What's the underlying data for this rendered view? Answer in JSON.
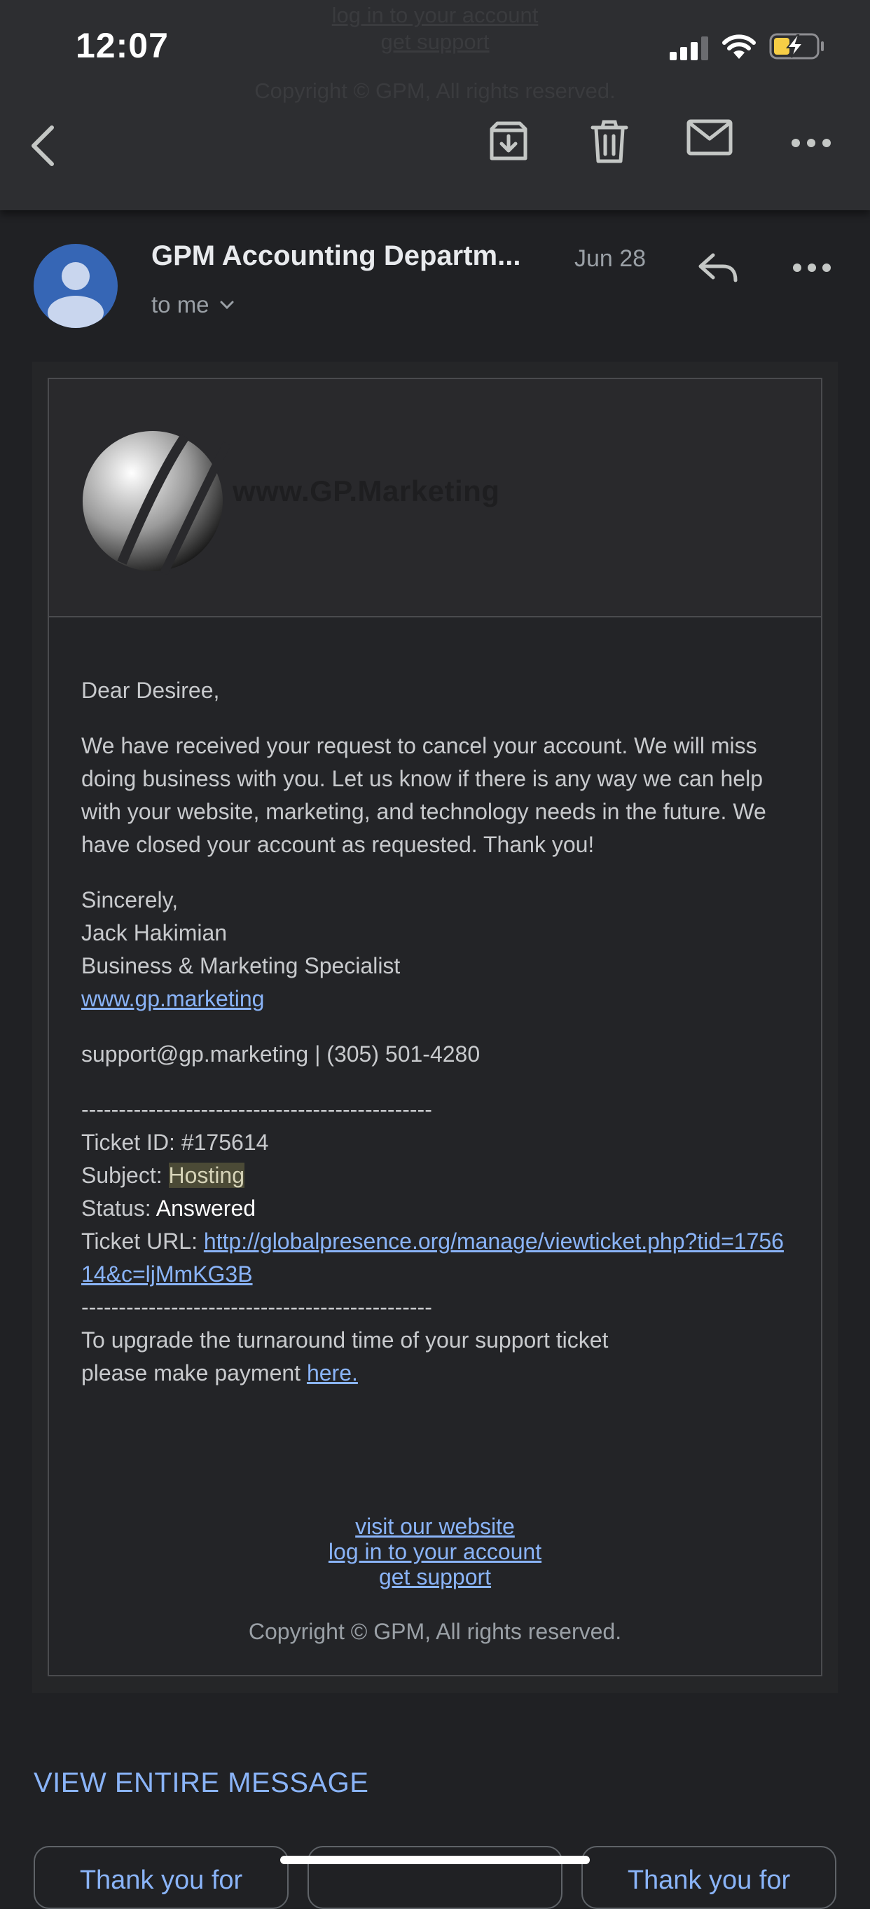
{
  "status_bar": {
    "time": "12:07"
  },
  "ghost_footer": {
    "line1": "log in to your account",
    "line2": "get support",
    "line3": "Copyright © GPM, All rights reserved."
  },
  "toolbar": {
    "back_icon": "chevron-left-icon",
    "archive_icon": "archive-icon",
    "delete_icon": "trash-icon",
    "mark_unread_icon": "mail-icon",
    "more_icon": "more-horizontal-icon"
  },
  "message": {
    "sender": "GPM Accounting Departm...",
    "date": "Jun 28",
    "recipients": "to me"
  },
  "email": {
    "logo_text": "www.GP.Marketing",
    "greeting": "Dear Desiree,",
    "paragraph": "We have received your request to cancel your account. We will miss doing business with you. Let us know if there is any way we can help with your website, marketing, and technology needs in the future. We have closed your account as requested. Thank you!",
    "closing": "Sincerely,",
    "signer_name": "Jack Hakimian",
    "signer_title": "Business & Marketing Specialist",
    "signer_site": "www.gp.marketing",
    "contact": "support@gp.marketing | (305) 501-4280",
    "divider": "-----------------------------------------------",
    "ticket_id_label": "Ticket ID: #175614",
    "subject_label": "Subject: ",
    "subject_value": "Hosting",
    "status_label": "Status: ",
    "status_value": "Answered",
    "ticket_url_label": "Ticket URL: ",
    "ticket_url_value": "http://globalpresence.org/manage/viewticket.php?tid=175614&c=ljMmKG3B",
    "upgrade_line1": "To upgrade the turnaround time of your support ticket",
    "upgrade_line2": "please make payment ",
    "upgrade_link": "here.",
    "footer_link1": "visit our website",
    "footer_link2": "log in to your account",
    "footer_link3": "get support",
    "copyright": "Copyright © GPM, All rights reserved."
  },
  "view_entire_message": "VIEW ENTIRE MESSAGE",
  "smart_replies": [
    "Thank you for",
    "",
    "Thank you for"
  ],
  "colors": {
    "background": "#202124",
    "appbar": "#2d2e31",
    "link": "#8ab4f8",
    "avatar": "#3666b5"
  }
}
